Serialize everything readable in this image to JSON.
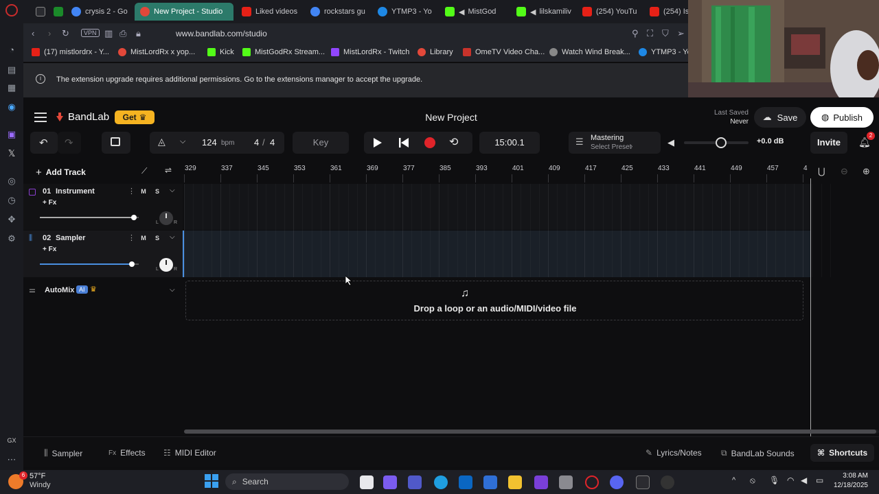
{
  "browser": {
    "tabs": [
      {
        "label": "",
        "fav": "#2a2b30"
      },
      {
        "label": "",
        "fav": "#1b8a2a"
      },
      {
        "label": "crysis 2 - Go",
        "fav": "#4285f4"
      },
      {
        "label": "New Project - Studio",
        "fav": "#e2483a"
      },
      {
        "label": "Liked videos",
        "fav": "#e62117"
      },
      {
        "label": "rockstars gu",
        "fav": "#4285f4"
      },
      {
        "label": "YTMP3 - Yo",
        "fav": "#1e88e5"
      },
      {
        "label": "MistGod",
        "fav": "#53fc18"
      },
      {
        "label": "lilskamiliv",
        "fav": "#53fc18"
      },
      {
        "label": "(254) YouTu",
        "fav": "#e62117"
      },
      {
        "label": "(254) Is",
        "fav": "#e62117"
      }
    ],
    "url": "www.bandlab.com/studio",
    "vpn": "VPN",
    "bookmarks": [
      {
        "label": "(17) mistlordrx - Y...",
        "fav": "#e62117"
      },
      {
        "label": "MistLordRx x yop...",
        "fav": "#e2483a"
      },
      {
        "label": "Kick",
        "fav": "#53fc18"
      },
      {
        "label": "MistGodRx Stream...",
        "fav": "#53fc18"
      },
      {
        "label": "MistLordRx - Twitch",
        "fav": "#9146ff"
      },
      {
        "label": "Library",
        "fav": "#e2483a"
      },
      {
        "label": "OmeTV Video Cha...",
        "fav": "#c8332b"
      },
      {
        "label": "Watch Wind Break...",
        "fav": "#888888"
      },
      {
        "label": "YTMP3 - Yo",
        "fav": "#1e88e5"
      }
    ]
  },
  "infobar": {
    "text": "The extension upgrade requires additional permissions. Go to the extensions manager to accept the upgrade."
  },
  "bandlab": {
    "brand": "BandLab",
    "get_label": "Get",
    "project_title": "New Project",
    "last_saved_label": "Last Saved",
    "last_saved_value": "Never",
    "save_label": "Save",
    "publish_label": "Publish",
    "bpm_value": "124",
    "bpm_unit": "bpm",
    "time_sig_num": "4",
    "time_sig_den": "4",
    "key_label": "Key",
    "time_display": "15:00.1",
    "mastering_label": "Mastering",
    "mastering_preset": "Select Preset",
    "volume_db": "+0.0 dB",
    "invite_label": "Invite",
    "notif_count": "2",
    "add_track_label": "Add Track",
    "ruler": [
      "329",
      "337",
      "345",
      "353",
      "361",
      "369",
      "377",
      "385",
      "393",
      "401",
      "409",
      "417",
      "425",
      "433",
      "441",
      "449",
      "457",
      "4"
    ],
    "tracks": [
      {
        "num": "01",
        "name": "Instrument",
        "fx": "+ Fx",
        "mute": "M",
        "solo": "S",
        "volume": 0.95
      },
      {
        "num": "02",
        "name": "Sampler",
        "fx": "+ Fx",
        "mute": "M",
        "solo": "S",
        "volume": 0.93
      }
    ],
    "automix_label": "AutoMix",
    "ai_badge": "AI",
    "drop_text": "Drop a loop or an audio/MIDI/video file",
    "bottom": {
      "sampler": "Sampler",
      "effects": "Effects",
      "midi_editor": "MIDI Editor",
      "lyrics": "Lyrics/Notes",
      "sounds": "BandLab Sounds",
      "shortcuts": "Shortcuts"
    }
  },
  "taskbar": {
    "temp": "57°F",
    "weather": "Windy",
    "weather_badge": "6",
    "search": "Search",
    "time": "3:08 AM",
    "date": "12/18/2025"
  },
  "colors": {
    "accent_red": "#e2483a",
    "get_yellow": "#f5b321",
    "record_red": "#e0242a"
  }
}
